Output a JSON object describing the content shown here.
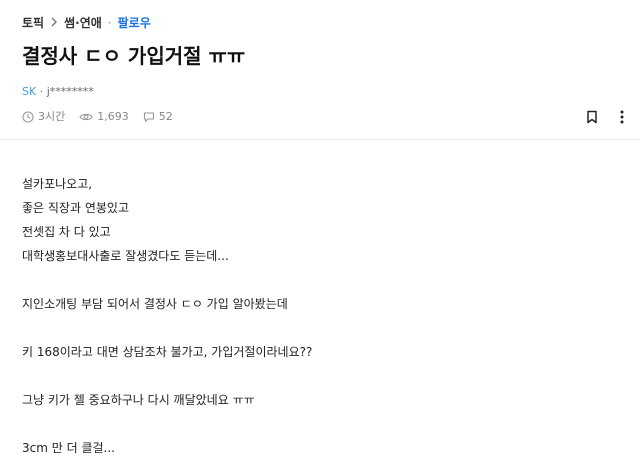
{
  "breadcrumb": {
    "topic": "토픽",
    "category": "썸·연애",
    "separator": "·",
    "follow": "팔로우"
  },
  "post": {
    "title": "결정사 ㄷㅇ 가입거절 ㅠㅠ",
    "author_company": "SK",
    "author_sep": " · ",
    "author_id": "j********",
    "time": "3시간",
    "views": "1,693",
    "comments": "52"
  },
  "icons": {
    "time": "clock-icon",
    "views": "eye-icon",
    "comments": "speech-bubble-icon",
    "bookmark": "bookmark-icon",
    "more": "more-vertical-icon"
  },
  "content": {
    "lines": [
      "설카포나오고,",
      "좋은 직장과 연봉있고",
      "전셋집 차 다 있고",
      "대학생홍보대사출로 잘생겼다도 듣는데...",
      "",
      "지인소개팅 부담 되어서 결정사 ㄷㅇ 가입 알아봤는데",
      "",
      "키 168이라고 대면 상담조차 불가고, 가입거절이라네요??",
      "",
      "그냥 키가 젤 중요하구나 다시 깨달았네요 ㅠㅠ",
      "",
      "3cm 만 더 클걸..."
    ]
  }
}
